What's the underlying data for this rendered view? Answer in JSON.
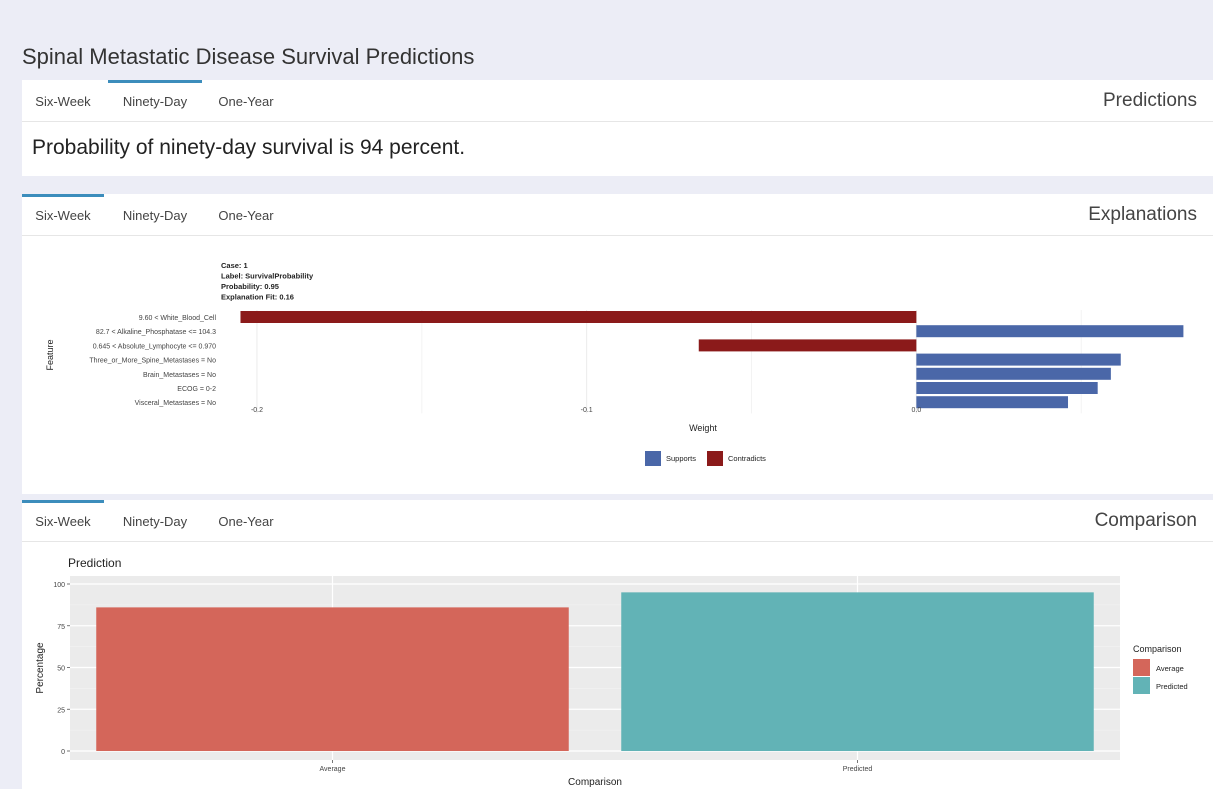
{
  "app": {
    "title": "Spinal Metastatic Disease Survival Predictions"
  },
  "predictions": {
    "title": "Predictions",
    "tabs": [
      {
        "label": "Six-Week",
        "active": false
      },
      {
        "label": "Ninety-Day",
        "active": true
      },
      {
        "label": "One-Year",
        "active": false
      }
    ],
    "text": "Probability of ninety-day survival is 94 percent."
  },
  "explanations": {
    "title": "Explanations",
    "tabs": [
      {
        "label": "Six-Week",
        "active": true
      },
      {
        "label": "Ninety-Day",
        "active": false
      },
      {
        "label": "One-Year",
        "active": false
      }
    ]
  },
  "comparison": {
    "title": "Comparison",
    "tabs": [
      {
        "label": "Six-Week",
        "active": true
      },
      {
        "label": "Ninety-Day",
        "active": false
      },
      {
        "label": "One-Year",
        "active": false
      }
    ]
  },
  "chart_data": [
    {
      "type": "bar",
      "orientation": "horizontal",
      "header_lines": [
        "Case: 1",
        "Label: SurvivalProbability",
        "Probability: 0.95",
        "Explanation Fit: 0.16"
      ],
      "ylabel": "Feature",
      "xlabel": "Weight",
      "categories": [
        "9.60 < White_Blood_Cell",
        "82.7 < Alkaline_Phosphatase <= 104.3",
        "0.645 < Absolute_Lymphocyte <= 0.970",
        "Three_or_More_Spine_Metastases = No",
        "Brain_Metastases = No",
        "ECOG = 0-2",
        "Visceral_Metastases = No"
      ],
      "values": [
        -0.205,
        0.081,
        -0.066,
        0.062,
        0.059,
        0.055,
        0.046
      ],
      "xlim": [
        -0.21,
        0.083
      ],
      "xticks": [
        -0.2,
        -0.1,
        0.0
      ],
      "xtick_labels": [
        "-0.2",
        "-0.1",
        "0.0"
      ],
      "legend": [
        {
          "name": "Supports",
          "color": "#4a67a8"
        },
        {
          "name": "Contradicts",
          "color": "#8b1a1a"
        }
      ],
      "legend_position": "bottom"
    },
    {
      "type": "bar",
      "title": "Prediction",
      "xlabel": "Comparison",
      "ylabel": "Percentage",
      "categories": [
        "Average",
        "Predicted"
      ],
      "values": [
        86,
        95
      ],
      "colors": [
        "#d4665a",
        "#62b3b6"
      ],
      "ylim": [
        0,
        100
      ],
      "yticks": [
        0,
        25,
        50,
        75,
        100
      ],
      "legend_title": "Comparison",
      "legend": [
        {
          "name": "Average",
          "color": "#d4665a"
        },
        {
          "name": "Predicted",
          "color": "#62b3b6"
        }
      ],
      "legend_position": "right"
    }
  ]
}
